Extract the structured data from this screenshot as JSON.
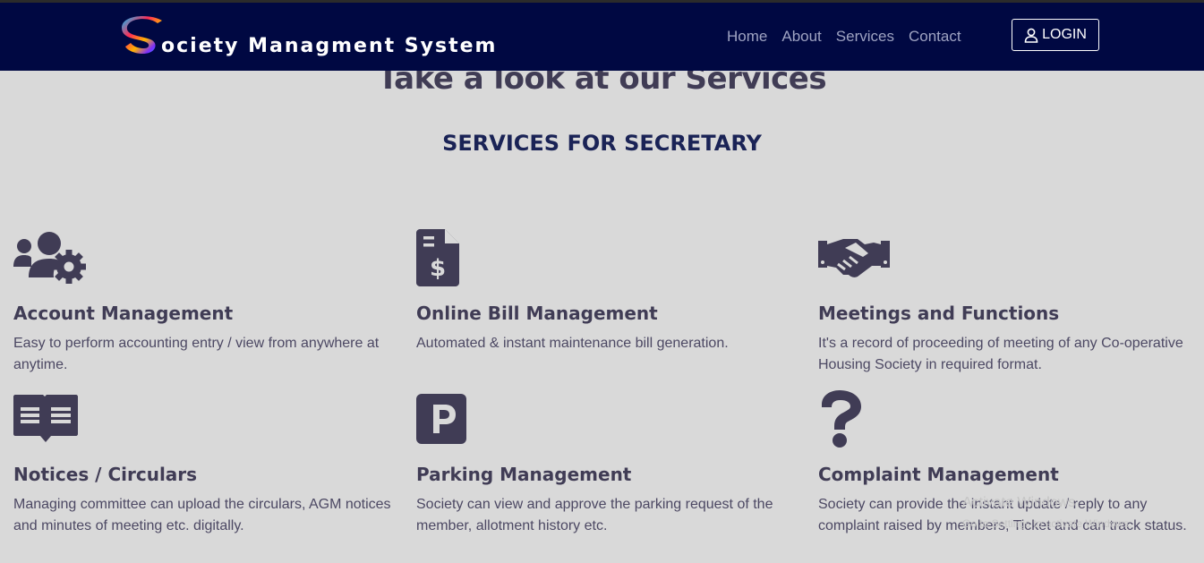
{
  "brand": {
    "name": "ociety Managment System",
    "logo_letter": "S"
  },
  "nav": {
    "items": [
      "Home",
      "About",
      "Services",
      "Contact"
    ],
    "login_label": "LOGIN"
  },
  "page": {
    "title": "Take a look at our Services",
    "subtitle": "SERVICES FOR SECRETARY"
  },
  "services": [
    {
      "icon": "users-gear-icon",
      "title": "Account Management",
      "desc": "Easy to perform accounting entry / view from anywhere at anytime."
    },
    {
      "icon": "invoice-dollar-icon",
      "title": "Online Bill Management",
      "desc": "Automated & instant maintenance bill generation."
    },
    {
      "icon": "handshake-icon",
      "title": "Meetings and Functions",
      "desc": "It's a record of proceeding of meeting of any Co-operative Housing Society in required format."
    },
    {
      "icon": "book-open-icon",
      "title": "Notices / Circulars",
      "desc": "Managing committee can upload the circulars, AGM notices and minutes of meeting etc. digitally."
    },
    {
      "icon": "parking-icon",
      "title": "Parking Management",
      "desc": "Society can view and approve the parking request of the member, allotment history etc."
    },
    {
      "icon": "question-icon",
      "title": "Complaint Management",
      "desc": "Society can provide the instant update / reply to any complaint raised by members, Ticket and can track status."
    }
  ],
  "watermark": {
    "line1": "Activate Windows",
    "line2": "Go to Settings to activate Windows."
  },
  "colors": {
    "navbar": "#000842",
    "background": "#d9d9d9",
    "heading": "#403c55",
    "subheading": "#1a2356"
  }
}
